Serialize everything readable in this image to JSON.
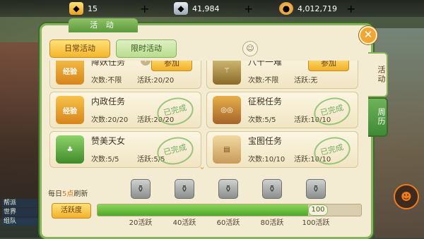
{
  "resources": [
    {
      "icon": "gold-ingot-icon",
      "value": "15"
    },
    {
      "icon": "silver-ingot-icon",
      "value": "41,984"
    },
    {
      "icon": "coin-icon",
      "value": "4,012,719"
    }
  ],
  "panel": {
    "title": "活 动",
    "tabs": [
      "日常活动",
      "限时活动"
    ],
    "side_tabs": [
      "活动",
      "周历"
    ]
  },
  "activities": [
    {
      "name": "降妖任务",
      "times": "次数:不限",
      "activity": "活跃:20/20",
      "action": "参加"
    },
    {
      "name": "八十一难",
      "times": "次数:不限",
      "activity": "活跃:无",
      "action": "参加"
    },
    {
      "name": "内政任务",
      "times": "次数:20/20",
      "activity": "活跃:20/20",
      "status": "已完成"
    },
    {
      "name": "征税任务",
      "times": "次数:5/5",
      "activity": "活跃:10/10",
      "status": "已完成"
    },
    {
      "name": "赞美天女",
      "times": "次数:5/5",
      "activity": "活跃:5/5",
      "status": "已完成"
    },
    {
      "name": "宝图任务",
      "times": "次数:10/10",
      "activity": "活跃:10/10",
      "status": "已完成"
    }
  ],
  "footer": {
    "refresh_prefix": "每日",
    "refresh_highlight": "5点",
    "refresh_suffix": "刷新",
    "activity_label": "活跃度",
    "activity_value": "100",
    "activity_max": 100,
    "milestones": [
      "20活跃",
      "40活跃",
      "60活跃",
      "80活跃",
      "100活跃"
    ]
  },
  "left_ui": [
    "帮派",
    "世界",
    "组队"
  ],
  "colors": {
    "accent": "#86b35c",
    "highlight": "#d7741e",
    "progress": "#4ea82a"
  }
}
